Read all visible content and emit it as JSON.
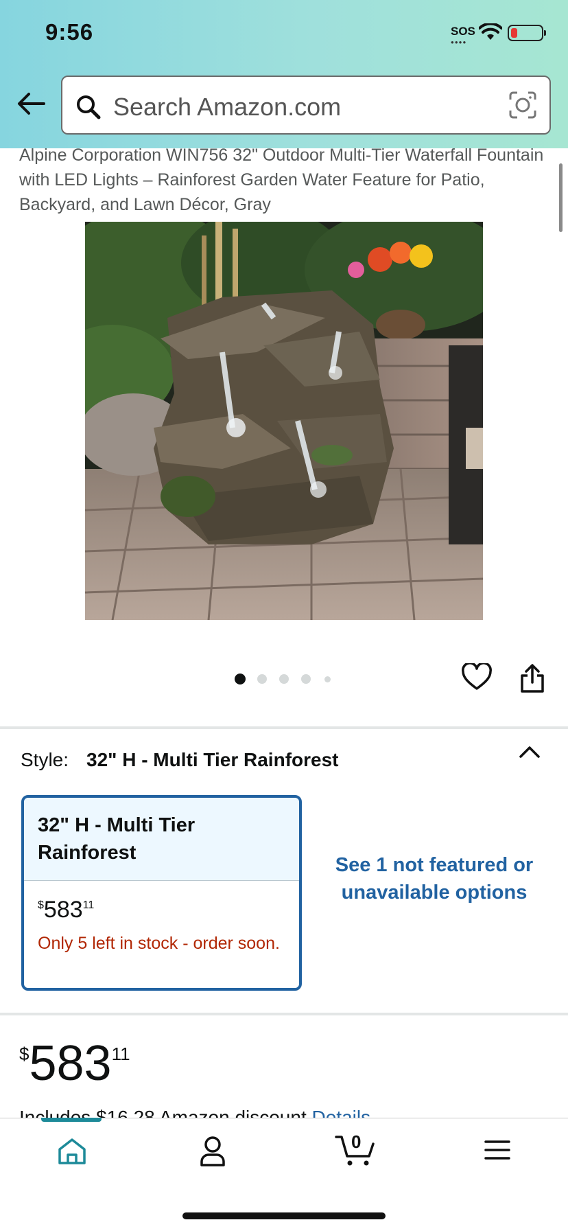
{
  "status_bar": {
    "time": "9:56",
    "sos": "SOS"
  },
  "search": {
    "placeholder": "Search Amazon.com"
  },
  "product": {
    "title": "Alpine Corporation WIN756 32\" Outdoor Multi-Tier Waterfall Fountain with LED Lights – Rainforest Garden Water Feature for Patio, Backyard, and Lawn Décor, Gray",
    "image_dots": 5,
    "active_dot": 0
  },
  "style": {
    "label": "Style:",
    "selected": "32\" H - Multi Tier Rainforest",
    "option": {
      "name": "32\" H - Multi Tier Rainforest",
      "price_symbol": "$",
      "price_whole": "583",
      "price_fraction": "11",
      "stock": "Only 5 left in stock - order soon."
    },
    "more_options": "See 1 not featured or unavailable options"
  },
  "price": {
    "symbol": "$",
    "whole": "583",
    "fraction": "11",
    "discount_text": "Includes $16.28 Amazon discount",
    "details_link": "Details"
  },
  "bottom_nav": {
    "cart_count": "0"
  },
  "colors": {
    "accent": "#2162a1",
    "stock": "#b12704",
    "home": "#1d8a99"
  }
}
